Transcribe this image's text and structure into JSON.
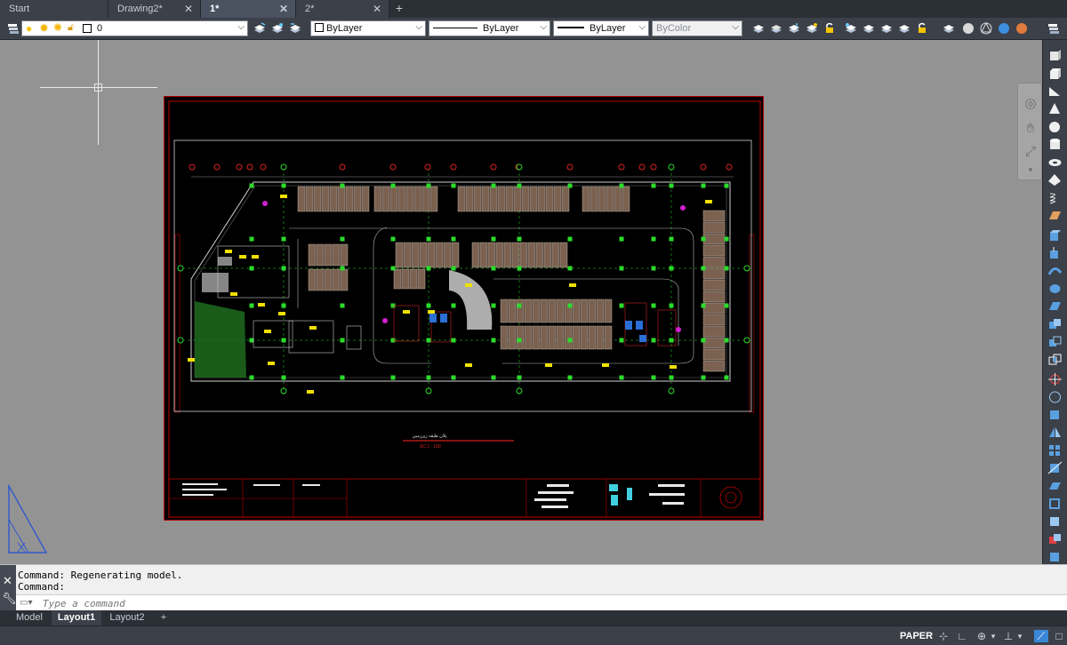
{
  "tabs": [
    {
      "label": "Start",
      "closable": false,
      "active": false
    },
    {
      "label": "Drawing2*",
      "closable": true,
      "active": false
    },
    {
      "label": "1*",
      "closable": true,
      "active": true
    },
    {
      "label": "2*",
      "closable": true,
      "active": false
    }
  ],
  "properties_bar": {
    "layer": "0",
    "color": "ByLayer",
    "linetype": "ByLayer",
    "lineweight": "ByLayer",
    "plot_style": "ByColor"
  },
  "drawing": {
    "title_text": "پلان طبقه زیرزمین",
    "scale_text": "SC 1 : 100"
  },
  "command_line": {
    "history": [
      "Command: Regenerating model.",
      "Command:"
    ],
    "placeholder": "Type a command"
  },
  "layout_tabs": [
    {
      "label": "Model",
      "active": false
    },
    {
      "label": "Layout1",
      "active": true
    },
    {
      "label": "Layout2",
      "active": false
    }
  ],
  "status_bar": {
    "space": "PAPER"
  },
  "colors": {
    "canvas_bg": "#939393",
    "sheet_bg": "#000000",
    "frame_red": "#c00000",
    "ui_dark": "#3b4049"
  }
}
